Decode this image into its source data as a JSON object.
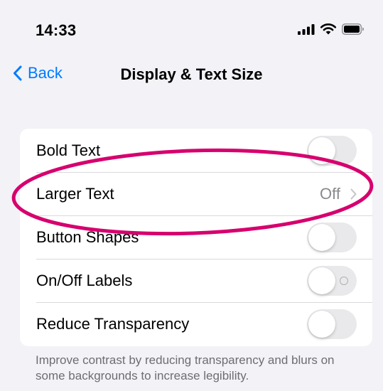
{
  "status_bar": {
    "time": "14:33",
    "icons": [
      "signal-icon",
      "wifi-icon",
      "battery-icon"
    ]
  },
  "nav": {
    "back_label": "Back",
    "title": "Display & Text Size"
  },
  "settings": {
    "rows": [
      {
        "label": "Bold Text",
        "control": "toggle",
        "on": false
      },
      {
        "label": "Larger Text",
        "control": "detail",
        "value": "Off"
      },
      {
        "label": "Button Shapes",
        "control": "toggle",
        "on": false
      },
      {
        "label": "On/Off Labels",
        "control": "toggle",
        "on": false
      },
      {
        "label": "Reduce Transparency",
        "control": "toggle",
        "on": false
      }
    ],
    "footer": "Improve contrast by reducing transparency and blurs on some backgrounds to increase legibility."
  },
  "colors": {
    "accent": "#007aff",
    "annotation": "#d6006e",
    "toggle_off": "#e9e9eb",
    "background": "#f2f2f7"
  }
}
